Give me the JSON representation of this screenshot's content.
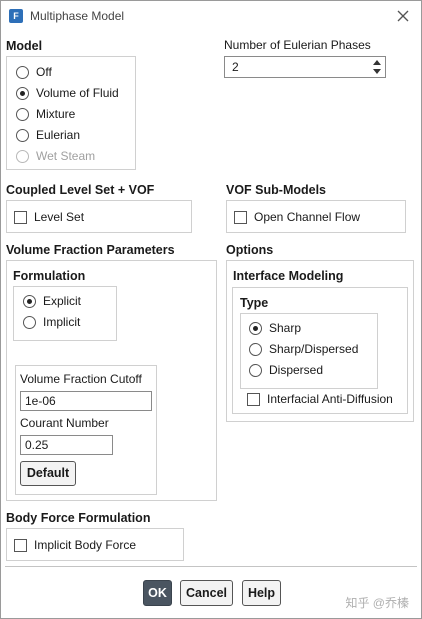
{
  "window": {
    "title": "Multiphase Model"
  },
  "model": {
    "label": "Model",
    "options": [
      {
        "label": "Off",
        "checked": false,
        "disabled": false
      },
      {
        "label": "Volume of Fluid",
        "checked": true,
        "disabled": false
      },
      {
        "label": "Mixture",
        "checked": false,
        "disabled": false
      },
      {
        "label": "Eulerian",
        "checked": false,
        "disabled": false
      },
      {
        "label": "Wet Steam",
        "checked": false,
        "disabled": true
      }
    ]
  },
  "phases": {
    "label": "Number of Eulerian Phases",
    "value": "2"
  },
  "coupled": {
    "label": "Coupled Level Set + VOF",
    "level_set_label": "Level Set"
  },
  "vof_sub": {
    "label": "VOF Sub-Models",
    "open_channel_label": "Open Channel Flow"
  },
  "vfp": {
    "label": "Volume Fraction Parameters",
    "formulation_label": "Formulation",
    "explicit_label": "Explicit",
    "implicit_label": "Implicit",
    "cutoff_label": "Volume Fraction Cutoff",
    "cutoff_value": "1e-06",
    "courant_label": "Courant Number",
    "courant_value": "0.25",
    "default_label": "Default"
  },
  "options": {
    "label": "Options",
    "interface_label": "Interface Modeling",
    "type_label": "Type",
    "sharp_label": "Sharp",
    "sharp_dispersed_label": "Sharp/Dispersed",
    "dispersed_label": "Dispersed",
    "anti_diffusion_label": "Interfacial Anti-Diffusion"
  },
  "body_force": {
    "label": "Body Force Formulation",
    "implicit_label": "Implicit Body Force"
  },
  "buttons": {
    "ok": "OK",
    "cancel": "Cancel",
    "help": "Help"
  },
  "watermark": "知乎 @乔榛"
}
